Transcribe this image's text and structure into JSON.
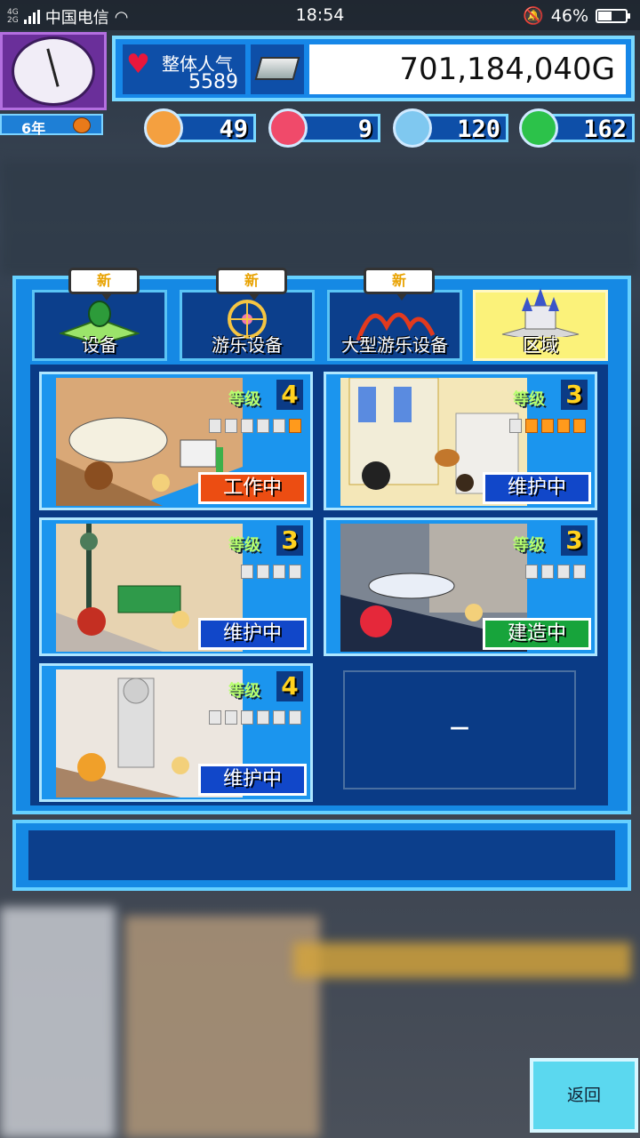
{
  "status_bar": {
    "network": "4G",
    "network2": "2G",
    "carrier": "中国电信",
    "time": "18:54",
    "battery": "46%"
  },
  "clock": {
    "year_label": "6年"
  },
  "header": {
    "popularity_label": "整体人气",
    "popularity_value": "5589",
    "money": "701,184,040G"
  },
  "resources": [
    {
      "name": "orange-icon",
      "value": "49",
      "color": "#f4a040"
    },
    {
      "name": "fire-icon",
      "value": "9",
      "color": "#f04a6a"
    },
    {
      "name": "water-drop-icon",
      "value": "120",
      "color": "#7fc8f0"
    },
    {
      "name": "clover-icon",
      "value": "162",
      "color": "#2cc24a"
    }
  ],
  "tabs": [
    {
      "label": "设备",
      "badge": "新"
    },
    {
      "label": "游乐设备",
      "badge": "新"
    },
    {
      "label": "大型游乐设备",
      "badge": "新"
    },
    {
      "label": "区域",
      "badge": ""
    }
  ],
  "areas": [
    {
      "level_label": "等级",
      "level": "4",
      "pips": [
        0,
        0,
        0,
        0,
        0,
        1
      ],
      "status": "工作中",
      "status_type": "working"
    },
    {
      "level_label": "等级",
      "level": "3",
      "pips": [
        0,
        1,
        1,
        1,
        1
      ],
      "status": "维护中",
      "status_type": "maint"
    },
    {
      "level_label": "等级",
      "level": "3",
      "pips": [
        0,
        0,
        0,
        0
      ],
      "status": "维护中",
      "status_type": "maint"
    },
    {
      "level_label": "等级",
      "level": "3",
      "pips": [
        0,
        0,
        0,
        0
      ],
      "status": "建造中",
      "status_type": "build"
    },
    {
      "level_label": "等级",
      "level": "4",
      "pips": [
        0,
        0,
        0,
        0,
        0,
        0
      ],
      "status": "维护中",
      "status_type": "maint"
    }
  ],
  "empty_slot": "—",
  "back_button": "返回"
}
